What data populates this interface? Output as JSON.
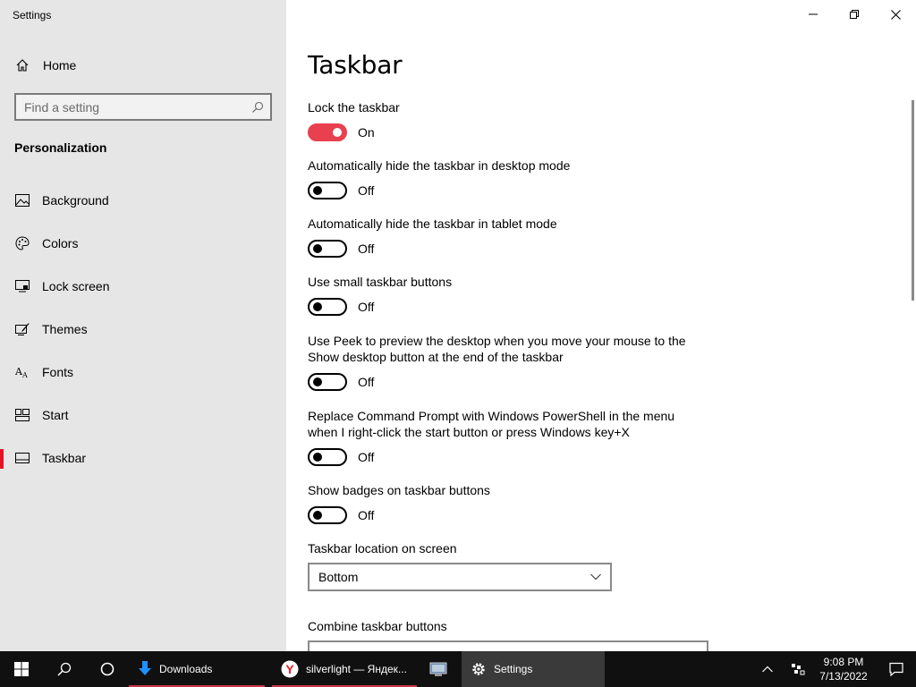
{
  "window": {
    "title": "Settings"
  },
  "sidebar": {
    "home_label": "Home",
    "search_placeholder": "Find a setting",
    "section_title": "Personalization",
    "items": [
      {
        "label": "Background",
        "icon": "image-icon"
      },
      {
        "label": "Colors",
        "icon": "palette-icon"
      },
      {
        "label": "Lock screen",
        "icon": "monitor-lock-icon"
      },
      {
        "label": "Themes",
        "icon": "brush-icon"
      },
      {
        "label": "Fonts",
        "icon": "fonts-icon"
      },
      {
        "label": "Start",
        "icon": "start-tiles-icon"
      },
      {
        "label": "Taskbar",
        "icon": "taskbar-icon",
        "active": true
      }
    ]
  },
  "main": {
    "page_title": "Taskbar",
    "settings": [
      {
        "label": "Lock the taskbar",
        "state": "On"
      },
      {
        "label": "Automatically hide the taskbar in desktop mode",
        "state": "Off"
      },
      {
        "label": "Automatically hide the taskbar in tablet mode",
        "state": "Off"
      },
      {
        "label": "Use small taskbar buttons",
        "state": "Off"
      },
      {
        "label": "Use Peek to preview the desktop when you move your mouse to the Show desktop button at the end of the taskbar",
        "state": "Off"
      },
      {
        "label": "Replace Command Prompt with Windows PowerShell in the menu when I right-click the start button or press Windows key+X",
        "state": "Off"
      },
      {
        "label": "Show badges on taskbar buttons",
        "state": "Off"
      }
    ],
    "location_label": "Taskbar location on screen",
    "location_value": "Bottom",
    "combine_label": "Combine taskbar buttons"
  },
  "taskbar": {
    "apps": [
      {
        "label": "Downloads",
        "icon": "download-arrow-icon"
      },
      {
        "label": "silverlight — Яндек...",
        "icon": "yandex-browser-icon"
      },
      {
        "label": "",
        "icon": "control-panel-icon"
      },
      {
        "label": "Settings",
        "icon": "gear-icon"
      }
    ],
    "time": "9:08 PM",
    "date": "7/13/2022"
  },
  "colors": {
    "accent": "#e8404e",
    "sidebar_bg": "#e6e6e6",
    "taskbar_bg": "#101010"
  }
}
